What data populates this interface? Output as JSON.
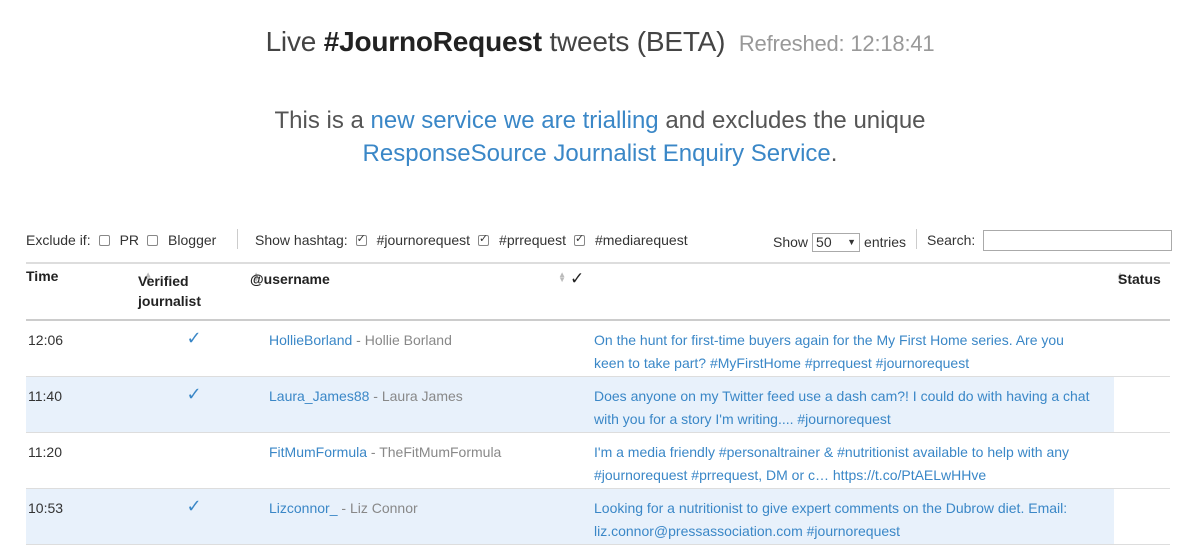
{
  "header": {
    "prefix": "Live",
    "brand": "#JournoRequest",
    "suffix": "tweets (BETA)",
    "refreshed": "Refreshed: 12:18:41"
  },
  "intro": {
    "part1": "This is a",
    "link1": "new service we are trialling",
    "part2": "and excludes the unique",
    "link2": "ResponseSource Journalist Enquiry Service",
    "end": "."
  },
  "controls": {
    "exclude_label": "Exclude if:",
    "exclude_pr": "PR",
    "exclude_blogger": "Blogger",
    "hashtag_label": "Show hashtag:",
    "hashtag_1": "#journorequest",
    "hashtag_2": "#prrequest",
    "hashtag_3": "#mediarequest",
    "show_label": "Show",
    "show_value": "50",
    "entries_label": "entries",
    "search_label": "Search:"
  },
  "table": {
    "headers": {
      "time": "Time",
      "verified": "Verified journalist",
      "username": "@username",
      "check": "✓",
      "status": "Status"
    },
    "rows": [
      {
        "time": "12:06",
        "verified": "✓",
        "username": "HollieBorland",
        "name": " - Hollie Borland",
        "tweet": "On the hunt for first-time buyers again for the My First Home series. Are you keen to take part? #MyFirstHome #prrequest #journorequest"
      },
      {
        "time": "11:40",
        "verified": "✓",
        "username": "Laura_James88",
        "name": " - Laura James",
        "tweet": "Does anyone on my Twitter feed use a dash cam?! I could do with having a chat with you for a story I'm writing.... #journorequest"
      },
      {
        "time": "11:20",
        "verified": "",
        "username": "FitMumFormula",
        "name": " - TheFitMumFormula",
        "tweet": "I'm a media friendly #personaltrainer & #nutritionist available to help with any #journorequest #prrequest, DM or c… https://t.co/PtAELwHHve"
      },
      {
        "time": "10:53",
        "verified": "✓",
        "username": "Lizconnor_",
        "name": " - Liz Connor",
        "tweet": "Looking for a nutritionist to give expert comments on the Dubrow diet. Email: liz.connor@pressassociation.com #journorequest"
      }
    ]
  },
  "colors": {
    "link": "#3a87c7",
    "row_alt": "#e8f1fb"
  }
}
